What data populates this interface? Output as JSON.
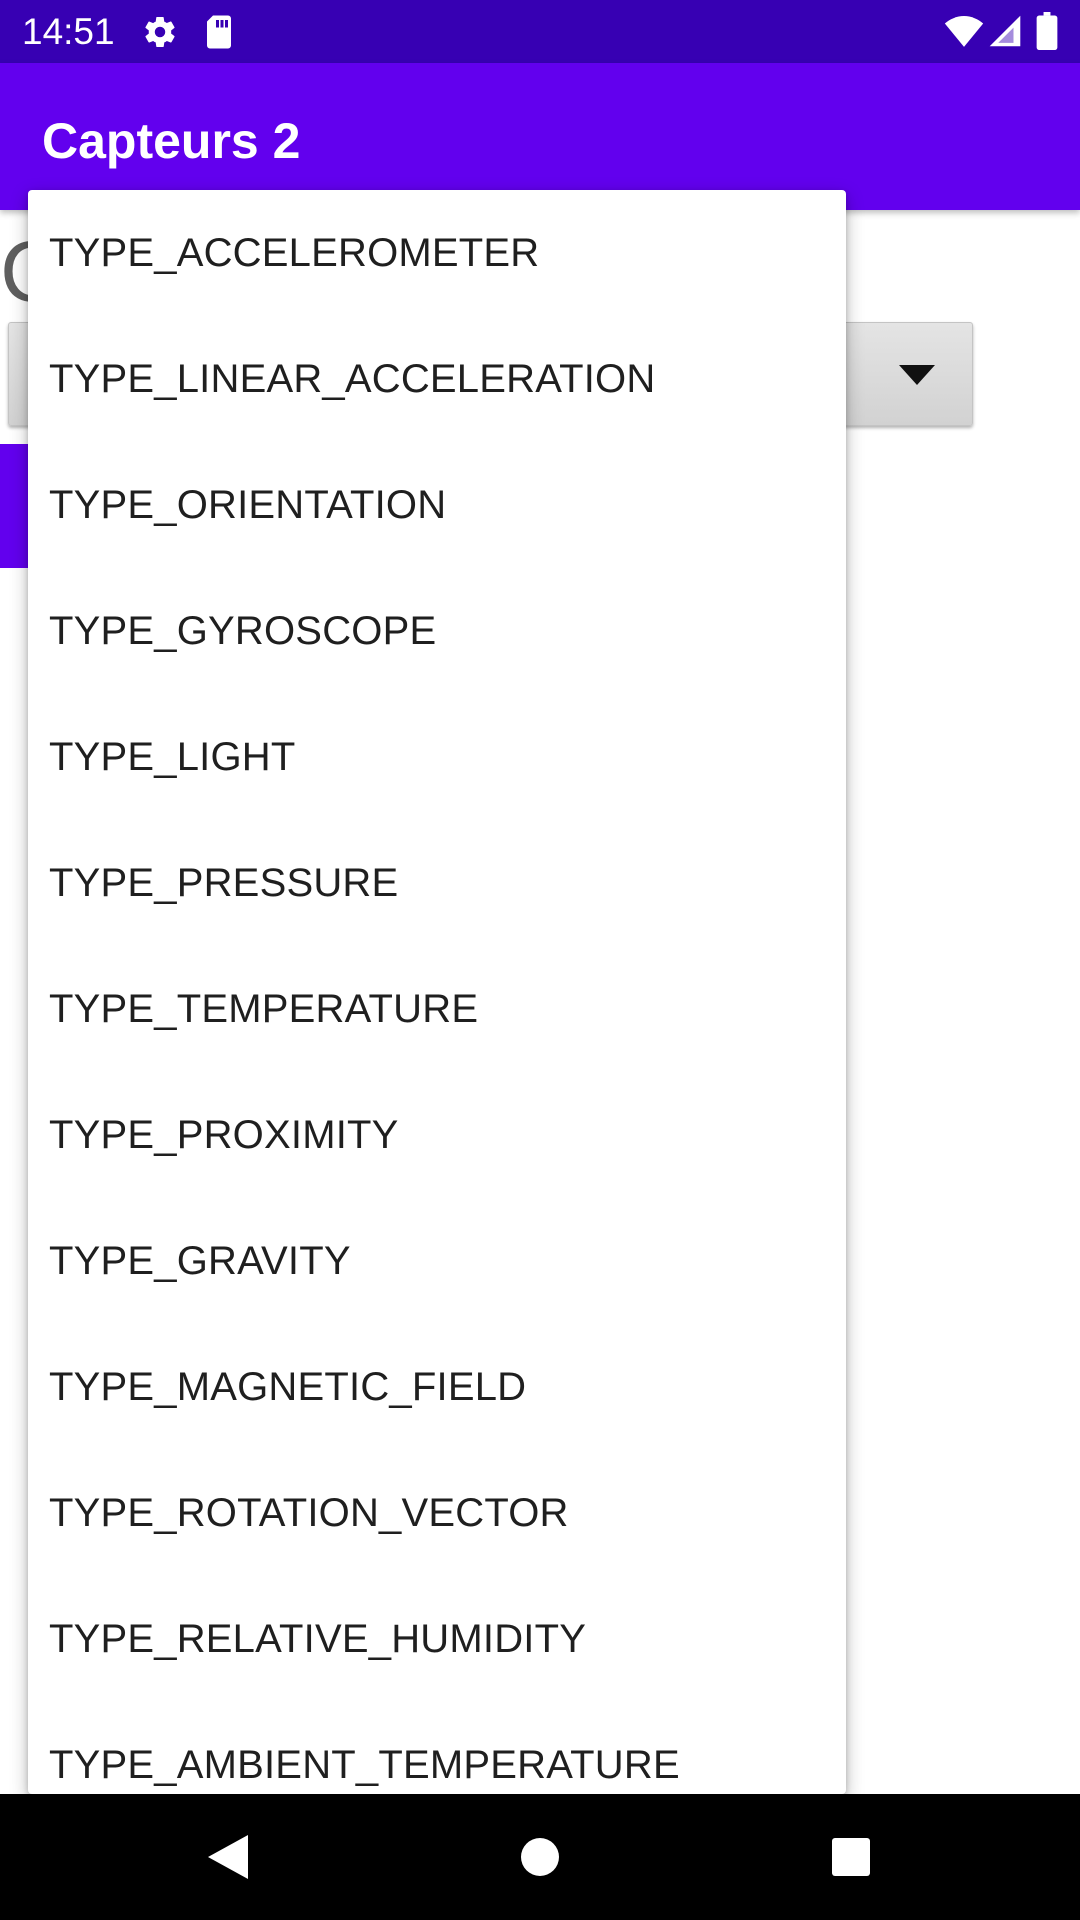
{
  "status_bar": {
    "time": "14:51",
    "icons": [
      "gear-icon",
      "sd-card-icon",
      "wifi-icon",
      "signal-icon",
      "battery-icon"
    ]
  },
  "app_bar": {
    "title": "Capteurs 2",
    "color": "#6200ee",
    "status_color": "#3700b3"
  },
  "dropdown": {
    "items": [
      "TYPE_ACCELEROMETER",
      "TYPE_LINEAR_ACCELERATION",
      "TYPE_ORIENTATION",
      "TYPE_GYROSCOPE",
      "TYPE_LIGHT",
      "TYPE_PRESSURE",
      "TYPE_TEMPERATURE",
      "TYPE_PROXIMITY",
      "TYPE_GRAVITY",
      "TYPE_MAGNETIC_FIELD",
      "TYPE_ROTATION_VECTOR",
      "TYPE_RELATIVE_HUMIDITY",
      "TYPE_AMBIENT_TEMPERATURE"
    ]
  },
  "nav_bar": {
    "icons": [
      "back-icon",
      "home-icon",
      "recents-icon"
    ]
  }
}
